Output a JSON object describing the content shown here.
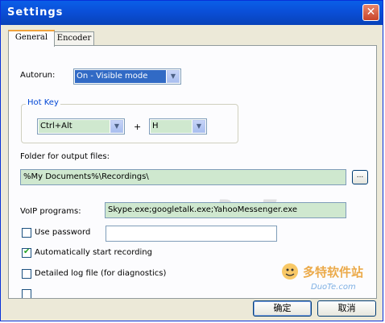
{
  "window": {
    "title": "Settings"
  },
  "tabs": [
    {
      "label": "General"
    },
    {
      "label": "Encoder"
    }
  ],
  "autorun": {
    "label": "Autorun:",
    "value": "On - Visible mode"
  },
  "hotkey": {
    "group_label": "Hot Key",
    "modifier": "Ctrl+Alt",
    "plus": "+",
    "key": "H"
  },
  "output_folder": {
    "label": "Folder for output files:",
    "value": "%My Documents%\\Recordings\\",
    "browse_label": "..."
  },
  "voip": {
    "label": "VoIP programs:",
    "value": "Skype.exe;googletalk.exe;YahooMessenger.exe"
  },
  "checkboxes": [
    {
      "label": "Use password",
      "checked": false
    },
    {
      "label": "Automatically start recording",
      "checked": true
    },
    {
      "label": "Detailed log file (for diagnostics)",
      "checked": false
    }
  ],
  "password": {
    "value": ""
  },
  "buttons": {
    "ok": "确定",
    "cancel": "取消"
  },
  "watermark": {
    "text": "www.DuoTe.com",
    "logo_text": "多特软件站",
    "logo_sub": "DuoTe.com"
  },
  "colors": {
    "titlebar": "#0a4fd8",
    "field_bg": "#cfe8cf",
    "selected": "#316ac5",
    "tab_accent": "#f1a33b"
  }
}
